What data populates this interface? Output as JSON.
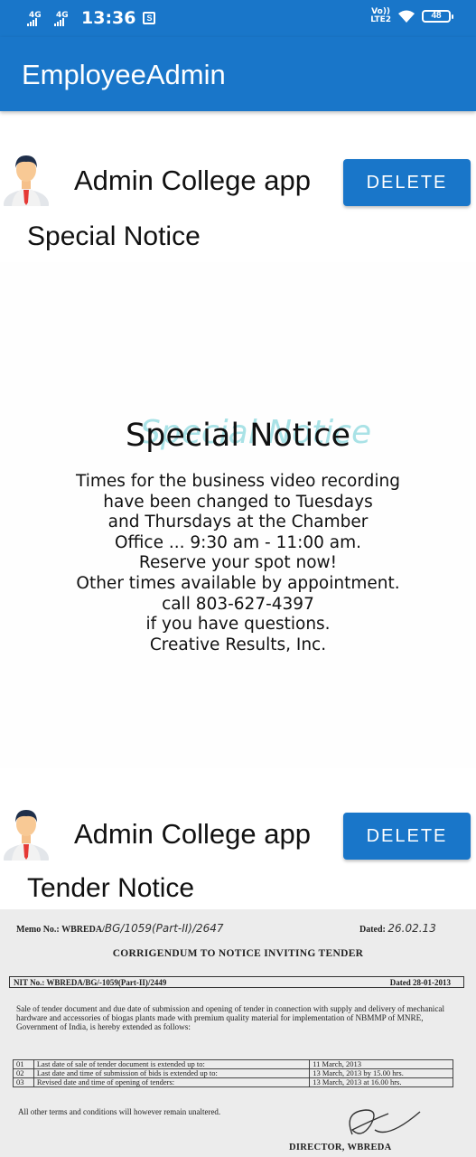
{
  "status_bar": {
    "network_1": "4G",
    "network_2": "4G",
    "time": "13:36",
    "volte_top": "Vo))",
    "volte_bottom": "LTE2",
    "battery": "48"
  },
  "app_bar": {
    "title": "EmployeeAdmin"
  },
  "posts": [
    {
      "author": "Admin College app",
      "delete_label": "DELETE",
      "notice_title": "Special Notice",
      "image": {
        "heading": "Special Notice",
        "body_lines": [
          "Times for the business video recording",
          "have been changed to Tuesdays",
          "and Thursdays at the Chamber",
          "Office ... 9:30 am - 11:00 am.",
          "Reserve your spot now!",
          "Other times available by appointment.",
          "call 803-627-4397",
          "if you have questions.",
          "Creative Results, Inc."
        ]
      }
    },
    {
      "author": "Admin College app",
      "delete_label": "DELETE",
      "notice_title": "Tender Notice",
      "image": {
        "memo_label": "Memo No.: WBREDA/",
        "memo_hand": "BG/1059(Part-II)/2647",
        "dated_label": "Dated:",
        "dated_hand": "26.02.13",
        "title": "CORRIGENDUM TO NOTICE INVITING TENDER",
        "nit": "NIT No.: WBREDA/BG/-1059(Part-II)/2449",
        "nit_dated": "Dated 28-01-2013",
        "paragraph": "Sale of tender document and due date of submission and opening of tender in connection with supply and delivery of mechanical hardware and accessories of biogas plants made with premium quality material for implementation of NBMMP of MNRE, Government of India, is hereby extended as follows:",
        "rows": [
          {
            "no": "01",
            "item": "Last date of sale of tender document is extended up to:",
            "value": "11 March, 2013"
          },
          {
            "no": "02",
            "item": "Last date and time of submission of bids is extended up to:",
            "value": "13 March, 2013 by 15.00 hrs."
          },
          {
            "no": "03",
            "item": "Revised date and time of opening of tenders:",
            "value": "13 March, 2013 at 16.00 hrs."
          }
        ],
        "footer": "All other terms and conditions will however remain unaltered.",
        "signatory": "DIRECTOR, WBREDA"
      }
    }
  ],
  "colors": {
    "primary": "#1976c9",
    "background": "#ffffff"
  },
  "icons": [
    "signal-icon",
    "sim-icon",
    "wifi-icon",
    "battery-icon",
    "avatar-icon",
    "signature-icon"
  ]
}
